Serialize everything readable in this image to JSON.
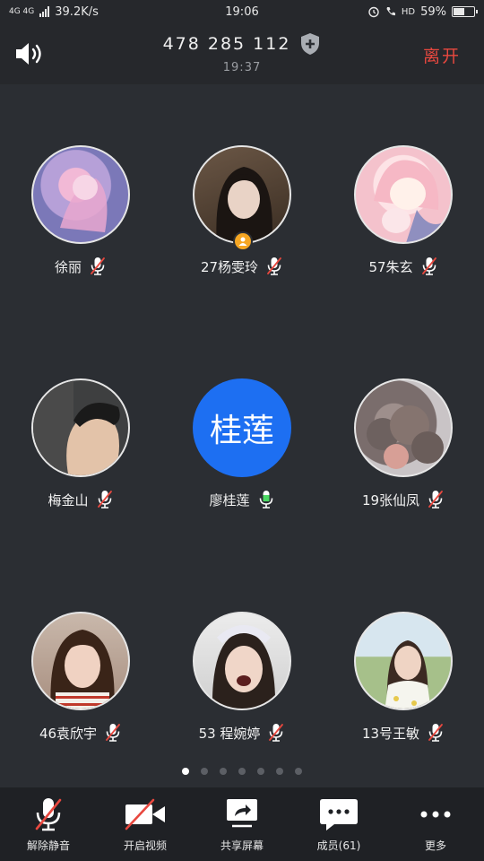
{
  "status_bar": {
    "network": "4G 4G",
    "speed": "39.2K/s",
    "time": "19:06",
    "hd": "HD",
    "battery_text": "59%",
    "battery_level": 0.59
  },
  "header": {
    "meeting_id": "478 285 112",
    "meeting_time": "19:37",
    "leave_label": "离开"
  },
  "participants": [
    {
      "name": "徐丽",
      "muted": true,
      "avatar": "anime-pink-hair-avatar"
    },
    {
      "name": "27杨雯玲",
      "muted": true,
      "avatar": "girl-short-hair-avatar",
      "host": true
    },
    {
      "name": "57朱玄",
      "muted": true,
      "avatar": "anime-bunny-girl-avatar"
    },
    {
      "name": "梅金山",
      "muted": true,
      "avatar": "man-profile-avatar"
    },
    {
      "name": "廖桂莲",
      "muted": false,
      "avatar_text": "桂莲"
    },
    {
      "name": "19张仙凤",
      "muted": true,
      "avatar": "flower-bush-avatar"
    },
    {
      "name": "46袁欣宇",
      "muted": true,
      "avatar": "girl-bangs-avatar"
    },
    {
      "name": "53 程婉婷",
      "muted": true,
      "avatar": "girl-laughing-avatar"
    },
    {
      "name": "13号王敏",
      "muted": true,
      "avatar": "girl-outdoor-avatar"
    }
  ],
  "pagination": {
    "pages": 7,
    "current": 1
  },
  "toolbar": {
    "unmute_label": "解除静音",
    "video_label": "开启视频",
    "share_label": "共享屏幕",
    "members_label": "成员(61)",
    "more_label": "更多"
  }
}
